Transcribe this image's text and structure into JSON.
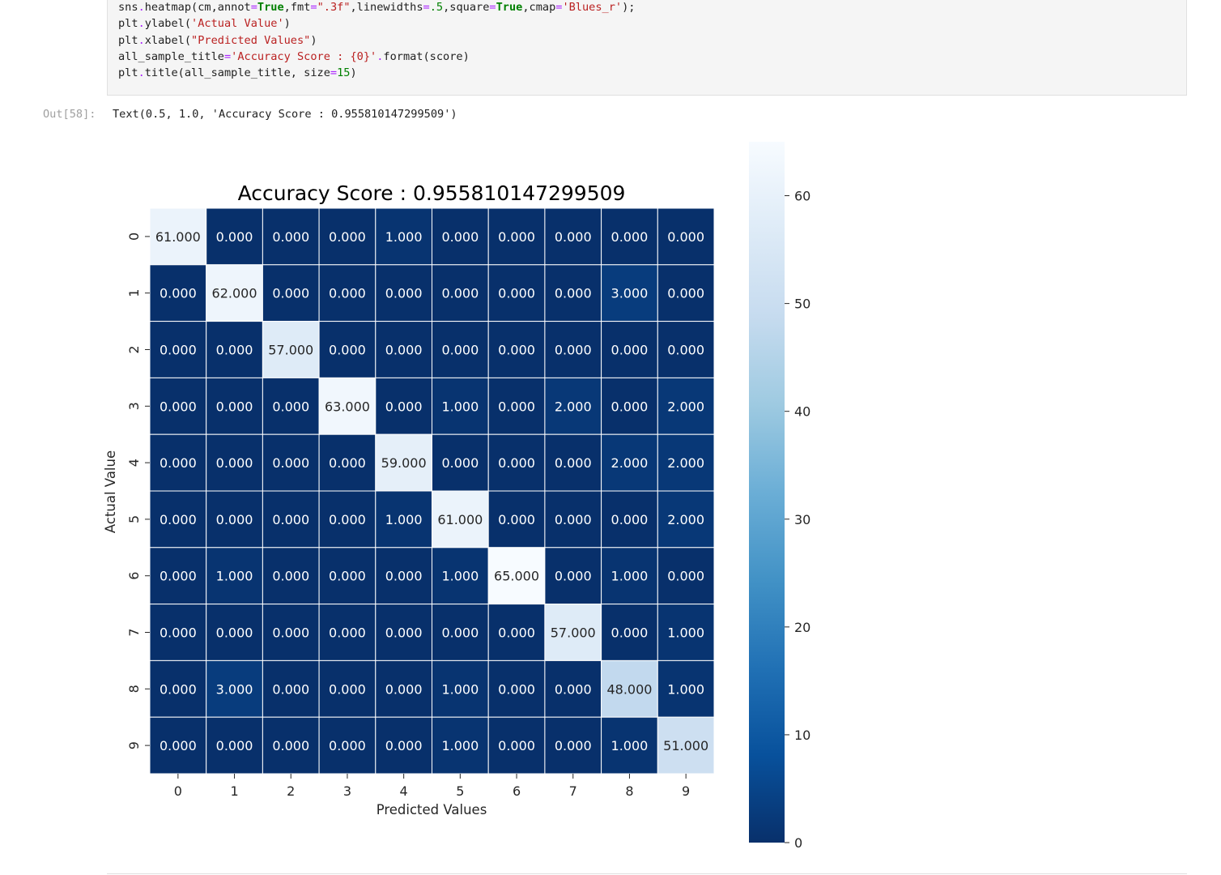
{
  "code": {
    "lines": [
      [
        {
          "t": "sns",
          "c": "name"
        },
        {
          "t": ".",
          "c": "op"
        },
        {
          "t": "heatmap(cm,annot",
          "c": "name"
        },
        {
          "t": "=",
          "c": "op"
        },
        {
          "t": "True",
          "c": "kw"
        },
        {
          "t": ",fmt",
          "c": "name"
        },
        {
          "t": "=",
          "c": "op"
        },
        {
          "t": "\".3f\"",
          "c": "str"
        },
        {
          "t": ",linewidths",
          "c": "name"
        },
        {
          "t": "=",
          "c": "op"
        },
        {
          "t": ".5",
          "c": "num"
        },
        {
          "t": ",square",
          "c": "name"
        },
        {
          "t": "=",
          "c": "op"
        },
        {
          "t": "True",
          "c": "kw"
        },
        {
          "t": ",cmap",
          "c": "name"
        },
        {
          "t": "=",
          "c": "op"
        },
        {
          "t": "'Blues_r'",
          "c": "str"
        },
        {
          "t": ");",
          "c": "name"
        }
      ],
      [
        {
          "t": "plt",
          "c": "name"
        },
        {
          "t": ".",
          "c": "op"
        },
        {
          "t": "ylabel(",
          "c": "name"
        },
        {
          "t": "'Actual Value'",
          "c": "str"
        },
        {
          "t": ")",
          "c": "name"
        }
      ],
      [
        {
          "t": "plt",
          "c": "name"
        },
        {
          "t": ".",
          "c": "op"
        },
        {
          "t": "xlabel(",
          "c": "name"
        },
        {
          "t": "\"Predicted Values\"",
          "c": "str"
        },
        {
          "t": ")",
          "c": "name"
        }
      ],
      [
        {
          "t": "all_sample_title",
          "c": "name"
        },
        {
          "t": "=",
          "c": "op"
        },
        {
          "t": "'Accuracy Score : {0}'",
          "c": "str"
        },
        {
          "t": ".",
          "c": "op"
        },
        {
          "t": "format(score)",
          "c": "name"
        }
      ],
      [
        {
          "t": "plt",
          "c": "name"
        },
        {
          "t": ".",
          "c": "op"
        },
        {
          "t": "title(all_sample_title, size",
          "c": "name"
        },
        {
          "t": "=",
          "c": "op"
        },
        {
          "t": "15",
          "c": "num"
        },
        {
          "t": ")",
          "c": "name"
        }
      ]
    ]
  },
  "output": {
    "prompt": "Out[58]:",
    "text": "Text(0.5, 1.0, 'Accuracy Score : 0.955810147299509')"
  },
  "chart_data": {
    "type": "heatmap",
    "title": "Accuracy Score : 0.955810147299509",
    "xlabel": "Predicted Values",
    "ylabel": "Actual Value",
    "x_categories": [
      "0",
      "1",
      "2",
      "3",
      "4",
      "5",
      "6",
      "7",
      "8",
      "9"
    ],
    "y_categories": [
      "0",
      "1",
      "2",
      "3",
      "4",
      "5",
      "6",
      "7",
      "8",
      "9"
    ],
    "values": [
      [
        61,
        0,
        0,
        0,
        1,
        0,
        0,
        0,
        0,
        0
      ],
      [
        0,
        62,
        0,
        0,
        0,
        0,
        0,
        0,
        3,
        0
      ],
      [
        0,
        0,
        57,
        0,
        0,
        0,
        0,
        0,
        0,
        0
      ],
      [
        0,
        0,
        0,
        63,
        0,
        1,
        0,
        2,
        0,
        2
      ],
      [
        0,
        0,
        0,
        0,
        59,
        0,
        0,
        0,
        2,
        2
      ],
      [
        0,
        0,
        0,
        0,
        1,
        61,
        0,
        0,
        0,
        2
      ],
      [
        0,
        1,
        0,
        0,
        0,
        1,
        65,
        0,
        1,
        0
      ],
      [
        0,
        0,
        0,
        0,
        0,
        0,
        0,
        57,
        0,
        1
      ],
      [
        0,
        3,
        0,
        0,
        0,
        1,
        0,
        0,
        48,
        1
      ],
      [
        0,
        0,
        0,
        0,
        0,
        1,
        0,
        0,
        1,
        51
      ]
    ],
    "annotation_format": ".3f",
    "colormap": "Blues_r",
    "vmin": 0,
    "vmax": 65,
    "colorbar_ticks": [
      0,
      10,
      20,
      30,
      40,
      50,
      60
    ]
  }
}
